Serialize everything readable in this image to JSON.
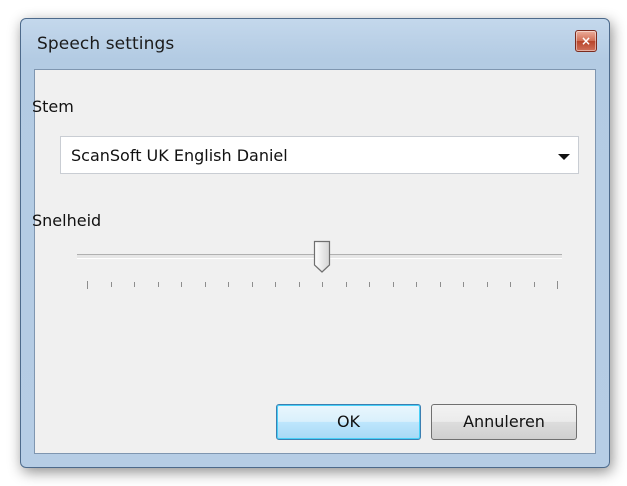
{
  "window": {
    "title": "Speech settings",
    "close_glyph": "×"
  },
  "form": {
    "voice_label": "Stem",
    "voice_selected": "ScanSoft UK English Daniel",
    "speed_label": "Snelheid",
    "speed_level": 0.5,
    "speed_tick_count": 21
  },
  "buttons": {
    "ok_label": "OK",
    "cancel_label": "Annuleren"
  },
  "icons": {
    "close": "close-icon",
    "dropdown": "chevron-down-icon",
    "slider_thumb": "slider-thumb-icon"
  },
  "colors": {
    "titlebar": "#b3cbe3",
    "client": "#f0f0f0",
    "close_button": "#c8563d",
    "default_button_border": "#3c7fb1"
  }
}
